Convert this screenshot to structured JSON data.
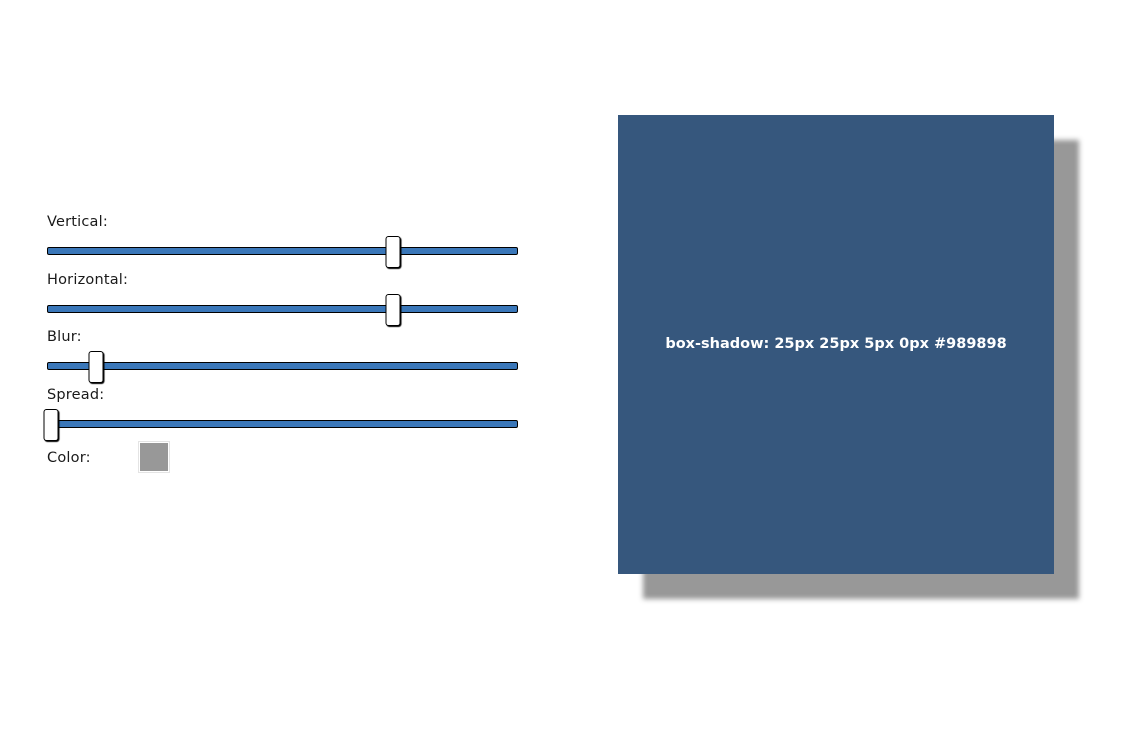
{
  "controls": [
    {
      "id": "vertical",
      "label": "Vertical:",
      "value": 25,
      "min": -50,
      "max": 50
    },
    {
      "id": "horizontal",
      "label": "Horizontal:",
      "value": 25,
      "min": -50,
      "max": 50
    },
    {
      "id": "blur",
      "label": "Blur:",
      "value": 5,
      "min": 0,
      "max": 50
    },
    {
      "id": "spread",
      "label": "Spread:",
      "value": 0,
      "min": 0,
      "max": 50
    }
  ],
  "color": {
    "label": "Color:",
    "value": "#989898"
  },
  "preview": {
    "text": "box-shadow: 25px 25px 5px 0px #989898",
    "background": "#36577d"
  }
}
